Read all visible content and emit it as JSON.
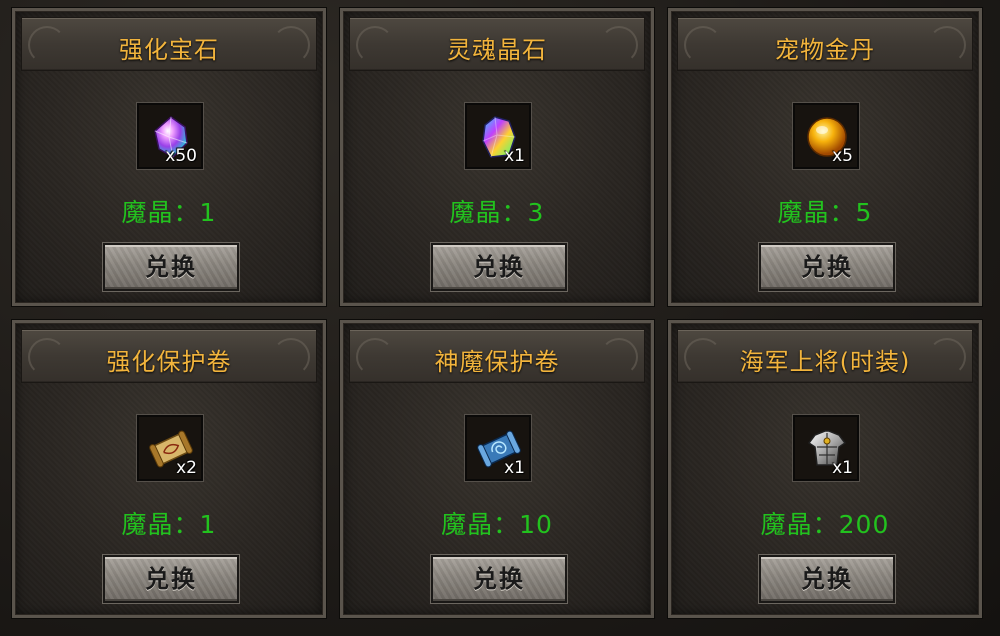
{
  "items": [
    {
      "title": "强化宝石",
      "qty": "x50",
      "price": "魔晶：1",
      "button": "兑换",
      "icon": "gem-icon"
    },
    {
      "title": "灵魂晶石",
      "qty": "x1",
      "price": "魔晶：3",
      "button": "兑换",
      "icon": "soul-crystal-icon"
    },
    {
      "title": "宠物金丹",
      "qty": "x5",
      "price": "魔晶：5",
      "button": "兑换",
      "icon": "golden-orb-icon"
    },
    {
      "title": "强化保护卷",
      "qty": "x2",
      "price": "魔晶：1",
      "button": "兑换",
      "icon": "scroll-icon"
    },
    {
      "title": "神魔保护卷",
      "qty": "x1",
      "price": "魔晶：10",
      "button": "兑换",
      "icon": "blue-scroll-icon"
    },
    {
      "title": "海军上将(时装)",
      "qty": "x1",
      "price": "魔晶：200",
      "button": "兑换",
      "icon": "armor-icon"
    }
  ],
  "colors": {
    "title": "#f2b43c",
    "price": "#22c21e"
  }
}
